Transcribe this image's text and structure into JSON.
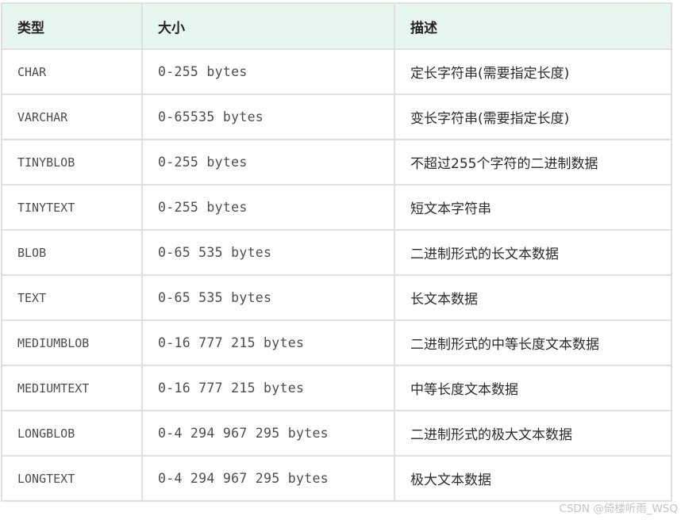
{
  "table": {
    "headers": [
      "类型",
      "大小",
      "描述"
    ],
    "rows": [
      {
        "type": "CHAR",
        "size": "0-255 bytes",
        "desc": "定长字符串(需要指定长度)"
      },
      {
        "type": "VARCHAR",
        "size": "0-65535 bytes",
        "desc": "变长字符串(需要指定长度)"
      },
      {
        "type": "TINYBLOB",
        "size": "0-255 bytes",
        "desc": "不超过255个字符的二进制数据"
      },
      {
        "type": "TINYTEXT",
        "size": "0-255 bytes",
        "desc": "短文本字符串"
      },
      {
        "type": "BLOB",
        "size": "0-65 535 bytes",
        "desc": "二进制形式的长文本数据"
      },
      {
        "type": "TEXT",
        "size": "0-65 535 bytes",
        "desc": "长文本数据"
      },
      {
        "type": "MEDIUMBLOB",
        "size": "0-16 777 215 bytes",
        "desc": "二进制形式的中等长度文本数据"
      },
      {
        "type": "MEDIUMTEXT",
        "size": "0-16 777 215 bytes",
        "desc": "中等长度文本数据"
      },
      {
        "type": "LONGBLOB",
        "size": "0-4 294 967 295 bytes",
        "desc": "二进制形式的极大文本数据"
      },
      {
        "type": "LONGTEXT",
        "size": "0-4 294 967 295 bytes",
        "desc": "极大文本数据"
      }
    ]
  },
  "watermark": "CSDN @倚楼听雨_WSQ",
  "colors": {
    "header_background": "#e8f6f0",
    "border": "#e0e0e0"
  }
}
